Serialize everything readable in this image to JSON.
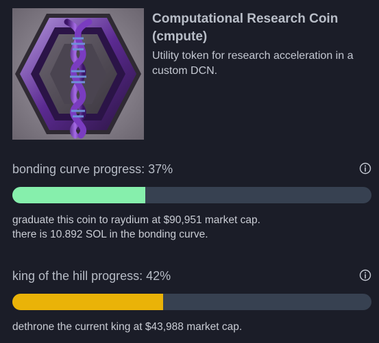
{
  "coin": {
    "title": "Computational Research Coin (cmpute)",
    "description": "Utility token for research acceleration in a custom DCN.",
    "image_icon": "hexagon-dna-helix-image"
  },
  "bonding_curve": {
    "label": "bonding curve progress: 37%",
    "progress": 0.37,
    "fill_color": "#86efac",
    "note_lines": [
      "graduate this coin to raydium at $90,951 market cap.",
      "there is 10.892 SOL in the bonding curve."
    ],
    "icon": "info-icon"
  },
  "king_of_the_hill": {
    "label": "king of the hill progress: 42%",
    "progress": 0.42,
    "fill_color": "#eab308",
    "note_lines": [
      "dethrone the current king at $43,988 market cap."
    ],
    "icon": "info-icon"
  },
  "colors": {
    "background": "#1b1d28",
    "track": "#374151"
  }
}
